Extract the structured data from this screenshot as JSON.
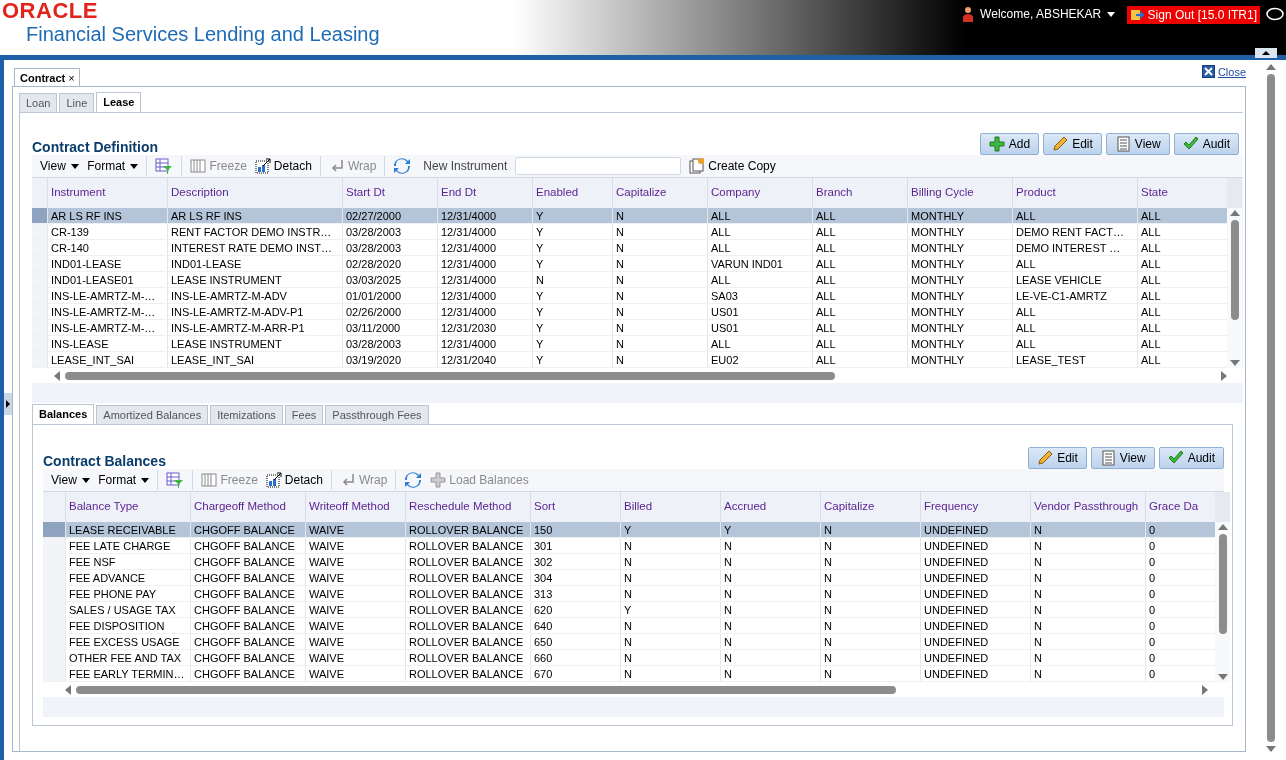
{
  "header": {
    "logo": "ORACLE",
    "product": "Financial Services Lending and Leasing",
    "welcome": "Welcome, ABSHEKAR",
    "signout": "Sign Out [15.0 ITR1]"
  },
  "page_tab": {
    "label": "Contract",
    "close": "×"
  },
  "close_link": "Close",
  "product_tabs": [
    {
      "label": "Loan",
      "selected": false
    },
    {
      "label": "Line",
      "selected": false
    },
    {
      "label": "Lease",
      "selected": true
    }
  ],
  "definition": {
    "title": "Contract Definition",
    "buttons": [
      {
        "kind": "add",
        "label": "Add"
      },
      {
        "kind": "edit",
        "label": "Edit"
      },
      {
        "kind": "view",
        "label": "View"
      },
      {
        "kind": "audit",
        "label": "Audit"
      }
    ],
    "toolbar": [
      [
        {
          "kind": "menu",
          "label": "View"
        },
        {
          "kind": "menu",
          "label": "Format"
        }
      ],
      [
        {
          "kind": "filter"
        }
      ],
      [
        {
          "kind": "freeze",
          "label": "Freeze",
          "disabled": true
        },
        {
          "kind": "detach",
          "label": "Detach",
          "disabled": false
        }
      ],
      [
        {
          "kind": "wrap",
          "label": "Wrap",
          "disabled": true
        }
      ],
      [
        {
          "kind": "refresh"
        },
        {
          "kind": "field",
          "label": "New Instrument"
        },
        {
          "kind": "copy",
          "label": "Create Copy",
          "disabled": false
        }
      ]
    ],
    "table": {
      "columns": [
        "Instrument",
        "Description",
        "Start Dt",
        "End Dt",
        "Enabled",
        "Capitalize",
        "Company",
        "Branch",
        "Billing Cycle",
        "Product",
        "State"
      ],
      "rows": [
        {
          "selected": true,
          "cells": [
            "AR LS RF INS",
            "AR LS RF INS",
            "02/27/2000",
            "12/31/4000",
            "Y",
            "N",
            "ALL",
            "ALL",
            "MONTHLY",
            "ALL",
            "ALL"
          ]
        },
        {
          "selected": false,
          "cells": [
            "CR-139",
            "RENT FACTOR DEMO INSTR…",
            "03/28/2003",
            "12/31/4000",
            "Y",
            "N",
            "ALL",
            "ALL",
            "MONTHLY",
            "DEMO RENT FACT…",
            "ALL"
          ]
        },
        {
          "selected": false,
          "cells": [
            "CR-140",
            "INTEREST RATE DEMO INST…",
            "03/28/2003",
            "12/31/4000",
            "Y",
            "N",
            "ALL",
            "ALL",
            "MONTHLY",
            "DEMO INTEREST …",
            "ALL"
          ]
        },
        {
          "selected": false,
          "cells": [
            "IND01-LEASE",
            "IND01-LEASE",
            "02/28/2020",
            "12/31/4000",
            "Y",
            "N",
            "VARUN IND01",
            "ALL",
            "MONTHLY",
            "ALL",
            "ALL"
          ]
        },
        {
          "selected": false,
          "cells": [
            "IND01-LEASE01",
            "LEASE INSTRUMENT",
            "03/03/2025",
            "12/31/4000",
            "N",
            "N",
            "ALL",
            "ALL",
            "MONTHLY",
            "LEASE VEHICLE",
            "ALL"
          ]
        },
        {
          "selected": false,
          "cells": [
            "INS-LE-AMRTZ-M-…",
            "INS-LE-AMRTZ-M-ADV",
            "01/01/2000",
            "12/31/4000",
            "Y",
            "N",
            "SA03",
            "ALL",
            "MONTHLY",
            "LE-VE-C1-AMRTZ",
            "ALL"
          ]
        },
        {
          "selected": false,
          "cells": [
            "INS-LE-AMRTZ-M-…",
            "INS-LE-AMRTZ-M-ADV-P1",
            "02/26/2000",
            "12/31/4000",
            "Y",
            "N",
            "US01",
            "ALL",
            "MONTHLY",
            "ALL",
            "ALL"
          ]
        },
        {
          "selected": false,
          "cells": [
            "INS-LE-AMRTZ-M-…",
            "INS-LE-AMRTZ-M-ARR-P1",
            "03/11/2000",
            "12/31/2030",
            "Y",
            "N",
            "US01",
            "ALL",
            "MONTHLY",
            "ALL",
            "ALL"
          ]
        },
        {
          "selected": false,
          "cells": [
            "INS-LEASE",
            "LEASE INSTRUMENT",
            "03/28/2003",
            "12/31/4000",
            "Y",
            "N",
            "ALL",
            "ALL",
            "MONTHLY",
            "ALL",
            "ALL"
          ]
        },
        {
          "selected": false,
          "cells": [
            "LEASE_INT_SAI",
            "LEASE_INT_SAI",
            "03/19/2020",
            "12/31/2040",
            "Y",
            "N",
            "EU02",
            "ALL",
            "MONTHLY",
            "LEASE_TEST",
            "ALL"
          ]
        }
      ]
    }
  },
  "balance_tabs": [
    {
      "label": "Balances",
      "selected": true
    },
    {
      "label": "Amortized Balances",
      "selected": false
    },
    {
      "label": "Itemizations",
      "selected": false
    },
    {
      "label": "Fees",
      "selected": false
    },
    {
      "label": "Passthrough Fees",
      "selected": false
    }
  ],
  "balances": {
    "title": "Contract Balances",
    "buttons": [
      {
        "kind": "edit",
        "label": "Edit"
      },
      {
        "kind": "view",
        "label": "View"
      },
      {
        "kind": "audit",
        "label": "Audit"
      }
    ],
    "toolbar": [
      [
        {
          "kind": "menu",
          "label": "View"
        },
        {
          "kind": "menu",
          "label": "Format"
        }
      ],
      [
        {
          "kind": "filter"
        }
      ],
      [
        {
          "kind": "freeze",
          "label": "Freeze",
          "disabled": true
        },
        {
          "kind": "detach",
          "label": "Detach",
          "disabled": false
        }
      ],
      [
        {
          "kind": "wrap",
          "label": "Wrap",
          "disabled": true
        }
      ],
      [
        {
          "kind": "refresh"
        },
        {
          "kind": "load",
          "label": "Load Balances",
          "disabled": true
        }
      ]
    ],
    "table": {
      "columns": [
        "Balance Type",
        "Chargeoff Method",
        "Writeoff Method",
        "Reschedule Method",
        "Sort",
        "Billed",
        "Accrued",
        "Capitalize",
        "Frequency",
        "Vendor Passthrough",
        "Grace Da"
      ],
      "rows": [
        {
          "selected": true,
          "cells": [
            "LEASE RECEIVABLE",
            "CHGOFF BALANCE",
            "WAIVE",
            "ROLLOVER BALANCE",
            "150",
            "Y",
            "Y",
            "N",
            "UNDEFINED",
            "N",
            "0"
          ]
        },
        {
          "selected": false,
          "cells": [
            "FEE LATE CHARGE",
            "CHGOFF BALANCE",
            "WAIVE",
            "ROLLOVER BALANCE",
            "301",
            "N",
            "N",
            "N",
            "UNDEFINED",
            "N",
            "0"
          ]
        },
        {
          "selected": false,
          "cells": [
            "FEE NSF",
            "CHGOFF BALANCE",
            "WAIVE",
            "ROLLOVER BALANCE",
            "302",
            "N",
            "N",
            "N",
            "UNDEFINED",
            "N",
            "0"
          ]
        },
        {
          "selected": false,
          "cells": [
            "FEE ADVANCE",
            "CHGOFF BALANCE",
            "WAIVE",
            "ROLLOVER BALANCE",
            "304",
            "N",
            "N",
            "N",
            "UNDEFINED",
            "N",
            "0"
          ]
        },
        {
          "selected": false,
          "cells": [
            "FEE PHONE PAY",
            "CHGOFF BALANCE",
            "WAIVE",
            "ROLLOVER BALANCE",
            "313",
            "N",
            "N",
            "N",
            "UNDEFINED",
            "N",
            "0"
          ]
        },
        {
          "selected": false,
          "cells": [
            "SALES / USAGE TAX",
            "CHGOFF BALANCE",
            "WAIVE",
            "ROLLOVER BALANCE",
            "620",
            "Y",
            "N",
            "N",
            "UNDEFINED",
            "N",
            "0"
          ]
        },
        {
          "selected": false,
          "cells": [
            "FEE DISPOSITION",
            "CHGOFF BALANCE",
            "WAIVE",
            "ROLLOVER BALANCE",
            "640",
            "N",
            "N",
            "N",
            "UNDEFINED",
            "N",
            "0"
          ]
        },
        {
          "selected": false,
          "cells": [
            "FEE EXCESS USAGE",
            "CHGOFF BALANCE",
            "WAIVE",
            "ROLLOVER BALANCE",
            "650",
            "N",
            "N",
            "N",
            "UNDEFINED",
            "N",
            "0"
          ]
        },
        {
          "selected": false,
          "cells": [
            "OTHER FEE AND TAX",
            "CHGOFF BALANCE",
            "WAIVE",
            "ROLLOVER BALANCE",
            "660",
            "N",
            "N",
            "N",
            "UNDEFINED",
            "N",
            "0"
          ]
        },
        {
          "selected": false,
          "cells": [
            "FEE EARLY TERMIN…",
            "CHGOFF BALANCE",
            "WAIVE",
            "ROLLOVER BALANCE",
            "670",
            "N",
            "N",
            "N",
            "UNDEFINED",
            "N",
            "0"
          ]
        }
      ]
    }
  }
}
